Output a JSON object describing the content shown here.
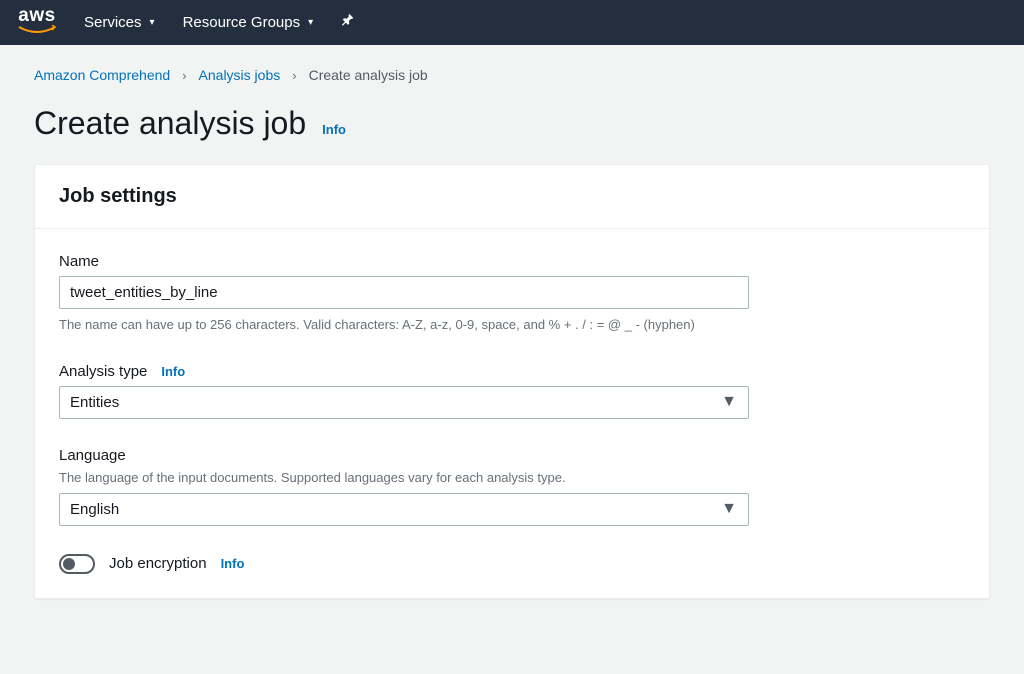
{
  "navbar": {
    "logo_text": "aws",
    "services_label": "Services",
    "resource_groups_label": "Resource Groups"
  },
  "breadcrumb": {
    "item1": "Amazon Comprehend",
    "item2": "Analysis jobs",
    "item3": "Create analysis job"
  },
  "page": {
    "title": "Create analysis job",
    "info_label": "Info"
  },
  "panel": {
    "title": "Job settings"
  },
  "form": {
    "name": {
      "label": "Name",
      "value": "tweet_entities_by_line",
      "hint": "The name can have up to 256 characters. Valid characters: A-Z, a-z, 0-9, space, and % + . / : = @ _ - (hyphen)"
    },
    "analysis_type": {
      "label": "Analysis type",
      "info_label": "Info",
      "value": "Entities"
    },
    "language": {
      "label": "Language",
      "desc": "The language of the input documents. Supported languages vary for each analysis type.",
      "value": "English"
    },
    "encryption": {
      "label": "Job encryption",
      "info_label": "Info",
      "enabled": false
    }
  }
}
